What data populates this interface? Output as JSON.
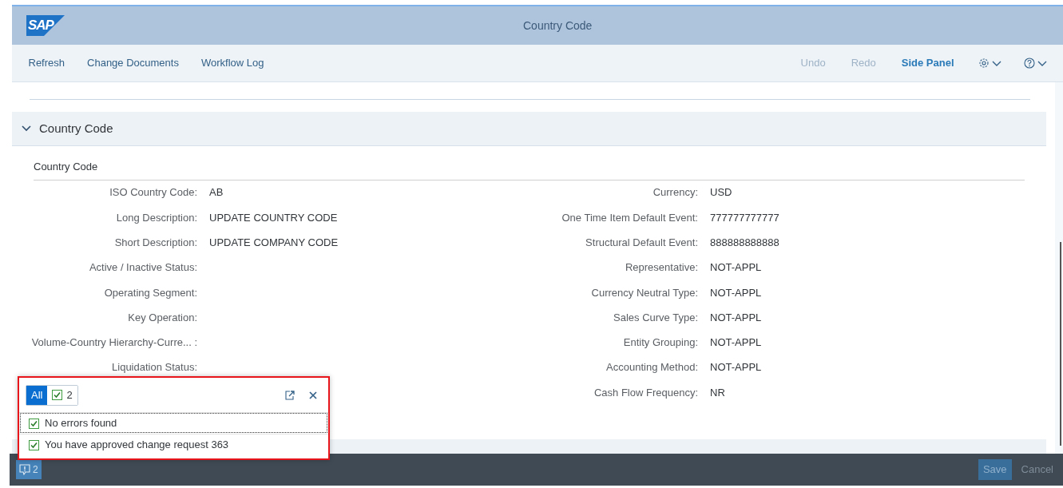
{
  "shell": {
    "logo": "SAP",
    "title": "Country Code"
  },
  "toolbar": {
    "left": [
      {
        "label": "Refresh",
        "disabled": false
      },
      {
        "label": "Change Documents",
        "disabled": false
      },
      {
        "label": "Workflow Log",
        "disabled": false
      }
    ],
    "right": [
      {
        "label": "Undo",
        "disabled": true
      },
      {
        "label": "Redo",
        "disabled": true
      },
      {
        "label": "Side Panel",
        "disabled": false
      }
    ],
    "menus": [
      {
        "kind": "settings"
      },
      {
        "kind": "help"
      }
    ]
  },
  "section": {
    "title": "Country Code",
    "expanded": true
  },
  "form": {
    "title": "Country Code",
    "left": [
      {
        "label": "ISO Country Code:",
        "value": "AB"
      },
      {
        "label": "Long Description:",
        "value": "UPDATE COUNTRY CODE"
      },
      {
        "label": "Short Description:",
        "value": "UPDATE COMPANY CODE"
      },
      {
        "label": "Active / Inactive Status:"
      },
      {
        "label": "Operating Segment:"
      },
      {
        "label": "Key Operation:"
      },
      {
        "label": "Volume-Country Hierarchy-Curre... :"
      },
      {
        "label": "Liquidation Status:"
      }
    ],
    "right": [
      {
        "label": "Currency:",
        "value": "USD"
      },
      {
        "label": "One Time Item Default Event:",
        "value": "777777777777"
      },
      {
        "label": "Structural Default Event:",
        "value": "888888888888"
      },
      {
        "label": "Representative:",
        "value": "NOT-APPL"
      },
      {
        "label": "Currency Neutral Type:",
        "value": "NOT-APPL"
      },
      {
        "label": "Sales Curve Type:",
        "value": "NOT-APPL"
      },
      {
        "label": "Entity Grouping:",
        "value": "NOT-APPL"
      },
      {
        "label": "Accounting Method:",
        "value": "NOT-APPL"
      },
      {
        "label": "Cash Flow Frequency:",
        "value": "NR"
      }
    ]
  },
  "message_popover": {
    "highlighted": true,
    "filters": [
      {
        "kind": "all",
        "label": "All",
        "selected": true
      },
      {
        "kind": "success",
        "label": "2",
        "selected": false
      }
    ],
    "messages": [
      {
        "kind": "success",
        "text": "No errors found",
        "focused": true
      },
      {
        "kind": "success",
        "text": "You have approved change request 363",
        "focused": false
      }
    ]
  },
  "footer": {
    "message_count": "2",
    "buttons": [
      {
        "label": "Save",
        "kind": "emphasized",
        "disabled": true
      },
      {
        "label": "Cancel",
        "kind": "transparent",
        "disabled": true
      }
    ]
  }
}
